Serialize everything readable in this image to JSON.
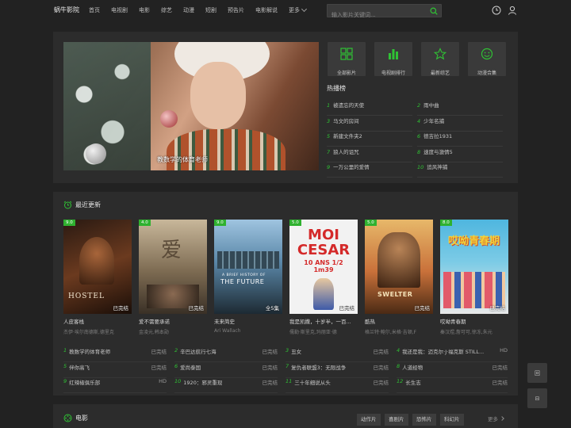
{
  "header": {
    "logo": "蜗牛影院",
    "nav": [
      "首页",
      "电视剧",
      "电影",
      "综艺",
      "动漫",
      "短剧",
      "预告片",
      "电影解说"
    ],
    "more": "更多",
    "search_placeholder": "输入影片关键词..."
  },
  "hero": {
    "banner_caption": "教数学的体育老师",
    "quick_links": [
      "全部影片",
      "电视剧排行",
      "最新综艺",
      "动漫合集"
    ],
    "hot_title": "热播榜",
    "hot": [
      {
        "n": "1",
        "title": "被遗忘的天使"
      },
      {
        "n": "2",
        "title": "雨中曲"
      },
      {
        "n": "3",
        "title": "马文的房间"
      },
      {
        "n": "4",
        "title": "少年名捕"
      },
      {
        "n": "5",
        "title": "新建文件夹2"
      },
      {
        "n": "6",
        "title": "德吉拉1931"
      },
      {
        "n": "7",
        "title": "狼人的诅咒"
      },
      {
        "n": "8",
        "title": "速度与激情5"
      },
      {
        "n": "9",
        "title": "一万公里的爱情"
      },
      {
        "n": "10",
        "title": "追风神捕"
      }
    ]
  },
  "recent": {
    "title": "最近更新",
    "posters": [
      {
        "score": "9.0",
        "status": "已完结",
        "title": "人皮客栈",
        "actors": "杰伊·埃尔南德斯,德里克",
        "poster_text": "HOSTEL",
        "colors": [
          "#2a1a12",
          "#6b3a1f",
          "#1a0e08"
        ]
      },
      {
        "score": "4.0",
        "status": "已完结",
        "title": "爱不需要承诺",
        "actors": "金凌元,韩本勋",
        "poster_text": "爱",
        "colors": [
          "#c8b79a",
          "#7d6b52",
          "#3a3026"
        ]
      },
      {
        "score": "9.0",
        "status": "全5集",
        "title": "未来简史",
        "actors": "Ari Wallach",
        "poster_text": "THE FUTURE",
        "poster_subtext": "A BRIEF HISTORY OF",
        "colors": [
          "#9fc4e0",
          "#5a87a8",
          "#1d2a33"
        ]
      },
      {
        "score": "5.0",
        "status": "已完结",
        "title": "我是凯撒，十岁半，一百...",
        "actors": "儒勒·斯里克,玛丽亚·德",
        "poster_text": "MOI CESAR",
        "poster_subtext": "10 ANS 1/2 1m39",
        "colors": [
          "#f2f2f2",
          "#d42a2a",
          "#f2f2f2"
        ]
      },
      {
        "score": "5.0",
        "status": "已完结",
        "title": "酷热",
        "actors": "格兰特·鲍尔,米格·吉顿,F",
        "poster_text": "SWELTER",
        "colors": [
          "#e7b86a",
          "#c9713a",
          "#4a2a14"
        ]
      },
      {
        "score": "8.0",
        "status": "已完结",
        "title": "哎呦青春期",
        "actors": "秦汉煜,詹可可,徐冻,朱元",
        "poster_text": "哎呦青春期",
        "colors": [
          "#4fb6df",
          "#f2d33a",
          "#e9e9e9"
        ]
      }
    ],
    "list": [
      {
        "n": "1",
        "title": "教数学的体育老师",
        "status": "已完结"
      },
      {
        "n": "2",
        "title": "辛巴达航行七海",
        "status": "已完结"
      },
      {
        "n": "3",
        "title": "丑女",
        "status": "已完结"
      },
      {
        "n": "4",
        "title": "我还是我：迈克尔·J·福克斯 STILL...",
        "status": "HD"
      },
      {
        "n": "5",
        "title": "伴你高飞",
        "status": "已完结"
      },
      {
        "n": "6",
        "title": "爱尚泰国",
        "status": "已完结"
      },
      {
        "n": "7",
        "title": "复仇者联盟3：无限战争",
        "status": "已完结"
      },
      {
        "n": "8",
        "title": "人道经物",
        "status": "已完结"
      },
      {
        "n": "9",
        "title": "红辣椒俱乐部",
        "status": "HD"
      },
      {
        "n": "10",
        "title": "1920：邪灵重现",
        "status": "已完结"
      },
      {
        "n": "11",
        "title": "三十年细说从头",
        "status": "已完结"
      },
      {
        "n": "12",
        "title": "长生志",
        "status": "已完结"
      }
    ]
  },
  "movie": {
    "title": "电影",
    "tags": [
      "动作片",
      "喜剧片",
      "恐怖片",
      "科幻片"
    ],
    "more": "更多"
  },
  "float": {
    "btn1": "回",
    "btn2": "⊟"
  },
  "colors": {
    "accent": "#2fc234",
    "bg": "#222222",
    "panel": "#2c2c2c"
  }
}
